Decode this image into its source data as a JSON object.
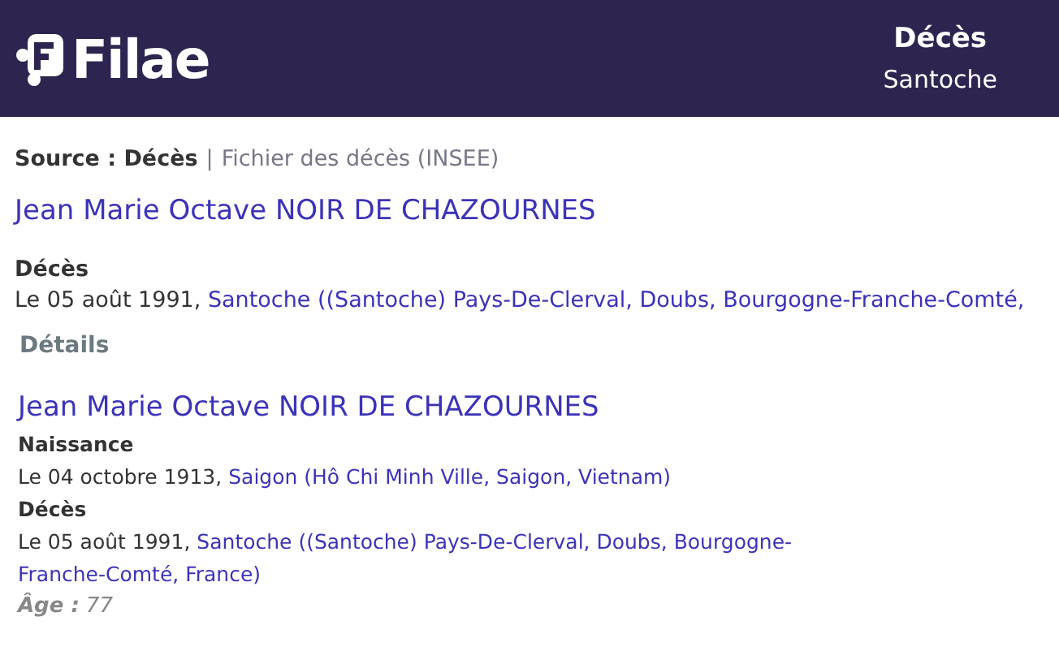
{
  "header": {
    "logo_text": "Filae",
    "title": "Décès",
    "subtitle": "Santoche"
  },
  "source": {
    "label": "Source : Décès",
    "separator": "|",
    "name": "Fichier des décès (INSEE)"
  },
  "record": {
    "name": "Jean Marie Octave NOIR DE CHAZOURNES",
    "events": [
      {
        "label": "Décès",
        "date": "Le 05 août 1991,",
        "place": "Santoche ((Santoche) Pays-De-Clerval, Doubs, Bourgogne-Franche-Comté,"
      }
    ]
  },
  "details": {
    "heading": "Détails",
    "name": "Jean Marie Octave NOIR DE CHAZOURNES",
    "events": [
      {
        "label": "Naissance",
        "date": "Le 04 octobre 1913,",
        "place": "Saigon (Hô Chi Minh Ville, Saigon, Vietnam)"
      },
      {
        "label": "Décès",
        "date": "Le 05 août 1991,",
        "place": "Santoche ((Santoche) Pays-De-Clerval, Doubs, Bourgogne-Franche-Comté, France)"
      }
    ],
    "age": {
      "label": "Âge :",
      "value": "77"
    }
  }
}
